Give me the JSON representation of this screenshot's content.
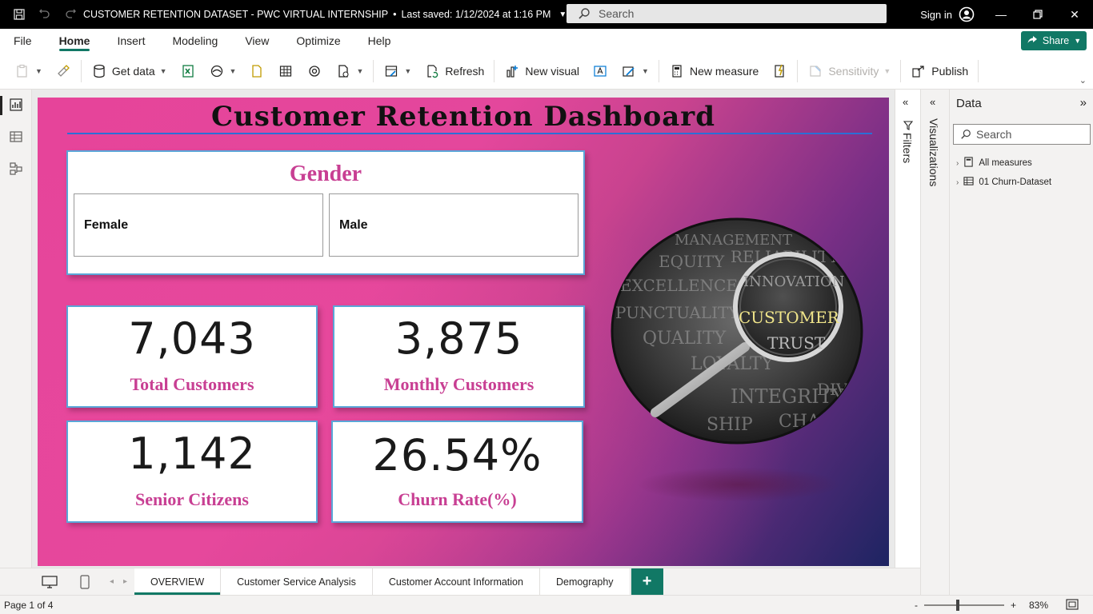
{
  "window": {
    "title": "CUSTOMER RETENTION DATASET - PWC VIRTUAL INTERNSHIP",
    "saved": "Last saved: 1/12/2024 at 1:16 PM",
    "search_placeholder": "Search",
    "signin": "Sign in"
  },
  "ribbon_tabs": [
    "File",
    "Home",
    "Insert",
    "Modeling",
    "View",
    "Optimize",
    "Help"
  ],
  "share_label": "Share",
  "toolbar": {
    "get_data": "Get data",
    "refresh": "Refresh",
    "new_visual": "New visual",
    "new_measure": "New measure",
    "sensitivity": "Sensitivity",
    "publish": "Publish"
  },
  "report": {
    "title": "Customer Retention Dashboard",
    "gender": {
      "title": "Gender",
      "options": [
        "Female",
        "Male"
      ]
    },
    "kpis": [
      {
        "value": "7,043",
        "label": "Total Customers"
      },
      {
        "value": "3,875",
        "label": "Monthly Customers"
      },
      {
        "value": "1,142",
        "label": "Senior Citizens"
      },
      {
        "value": "26.54%",
        "label": "Churn Rate(%)"
      }
    ],
    "image_words": [
      "CUSTOMER",
      "TRUST",
      "INTEGRITY",
      "RELIABILITY",
      "QUALITY",
      "INNOVATION",
      "EXCELLENCE",
      "LOYALTY",
      "SHIP",
      "CHALLENGE",
      "DIVERSITY",
      "PUNCTUALITY",
      "MANAGEMENT",
      "EQUITY"
    ]
  },
  "panes": {
    "filters": "Filters",
    "visualizations": "Visualizations",
    "data": {
      "title": "Data",
      "search_placeholder": "Search",
      "items": [
        "All measures",
        "01 Churn-Dataset"
      ]
    }
  },
  "pages": [
    "OVERVIEW",
    "Customer Service Analysis",
    "Customer Account Information",
    "Demography"
  ],
  "status": {
    "page": "Page 1 of 4",
    "zoom": "83%"
  },
  "colors": {
    "accent": "#117865",
    "kpi_label": "#c83f93",
    "card_border": "#5aa6d8"
  }
}
